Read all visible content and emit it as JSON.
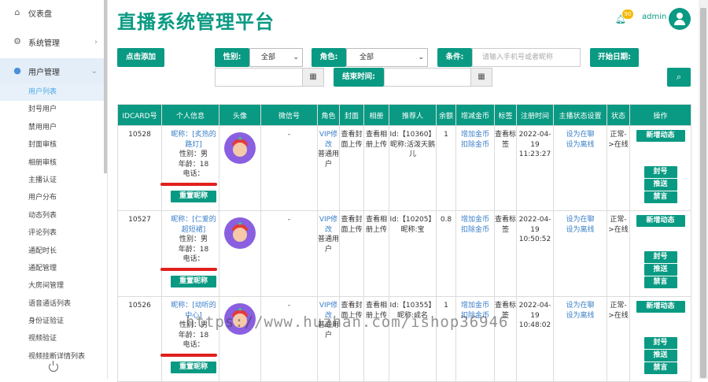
{
  "sidebar": {
    "top_items": [
      {
        "label": "仪表盘",
        "icon": "home-icon"
      },
      {
        "label": "系统管理",
        "icon": "gears-icon"
      },
      {
        "label": "用户管理",
        "icon": "user-icon"
      }
    ],
    "sub_items": [
      "用户列表",
      "封号用户",
      "禁用用户",
      "封面审核",
      "相册审核",
      "主播认证",
      "用户分布",
      "动态列表",
      "评论列表",
      "通配时长",
      "通配管理",
      "大房间管理",
      "语音通话列表",
      "身份证验证",
      "视频验证",
      "视频挂断详情列表"
    ]
  },
  "header": {
    "title": "直播系统管理平台",
    "badge": "90",
    "user": "admin"
  },
  "toolbar": {
    "add_button": "点击添加",
    "gender_label": "性别:",
    "gender_value": "全部",
    "role_label": "角色:",
    "role_value": "全部",
    "condition_label": "条件:",
    "condition_placeholder": "请输入手机号或者昵称",
    "start_date_label": "开始日期:",
    "end_time_label": "结束时间:"
  },
  "table": {
    "headers": [
      "IDCARD号",
      "个人信息",
      "头像",
      "微信号",
      "角色",
      "封面",
      "相册",
      "推荐人",
      "余额",
      "增减金币",
      "标签",
      "注册时间",
      "主播状态设置",
      "状态",
      "操作"
    ],
    "rows": [
      {
        "id": "10528",
        "nick_prefix": "昵称：[",
        "nick": "炙热的路灯",
        "nick_suffix": "]",
        "gender": "性别：男",
        "age_label": "年龄：",
        "age": "18",
        "phone": "电话：",
        "rename": "重置昵称",
        "wechat": "-",
        "role_vip": "VIP修改",
        "role_type": "普通用户",
        "cover": "查看封面上传",
        "album": "查看相册上传",
        "referrer": "Id:【10360】昵称:活泼天鹅儿",
        "balance": "1",
        "coins_add": "增加金币",
        "coins_sub": "扣除金币",
        "tag": "查看标签",
        "reg_date": "2022-04-19",
        "reg_time": "11:23:27",
        "set_busy": "设为在聊",
        "set_offline": "设为离线",
        "status": "正常->在线",
        "op_new": "新增动态",
        "op_ban": "封号",
        "op_push": "推送",
        "op_mute": "禁言"
      },
      {
        "id": "10527",
        "nick_prefix": "昵称：[",
        "nick": "仁爱的超短裙",
        "nick_suffix": "]",
        "gender": "性别：男",
        "age_label": "年龄：",
        "age": "18",
        "phone": "电话：",
        "rename": "重置昵称",
        "wechat": "-",
        "role_vip": "VIP修改",
        "role_type": "普通用户",
        "cover": "查看封面上传",
        "album": "查看相册上传",
        "referrer": "Id:【10205】昵称:宝",
        "balance": "0.8",
        "coins_add": "增加金币",
        "coins_sub": "扣除金币",
        "tag": "查看标签",
        "reg_date": "2022-04-19",
        "reg_time": "10:50:52",
        "set_busy": "设为在聊",
        "set_offline": "设为离线",
        "status": "正常->在线",
        "op_new": "新增动态",
        "op_ban": "封号",
        "op_push": "推送",
        "op_mute": "禁言"
      },
      {
        "id": "10526",
        "nick_prefix": "昵称：[",
        "nick": "动听的中心",
        "nick_suffix": "]",
        "gender": "性别：男",
        "age_label": "年龄：",
        "age": "18",
        "phone": "电话：",
        "rename": "重置昵称",
        "wechat": "-",
        "role_vip": "VIP修改",
        "role_type": "普通用户",
        "cover": "查看封面上传",
        "album": "查看相册上传",
        "referrer": "Id:【10355】昵称:成名",
        "balance": "1",
        "coins_add": "增加金币",
        "coins_sub": "扣除金币",
        "tag": "查看标签",
        "reg_date": "2022-04-19",
        "reg_time": "10:48:02",
        "set_busy": "设为在聊",
        "set_offline": "设为离线",
        "status": "正常->在线",
        "op_new": "新增动态",
        "op_ban": "封号",
        "op_push": "推送",
        "op_mute": "禁言"
      }
    ]
  },
  "watermark": "https://www.huzhan.com/ishop36946",
  "colors": {
    "primary": "#0a9a83",
    "link": "#3a7fc8",
    "badge": "#f5b800"
  }
}
